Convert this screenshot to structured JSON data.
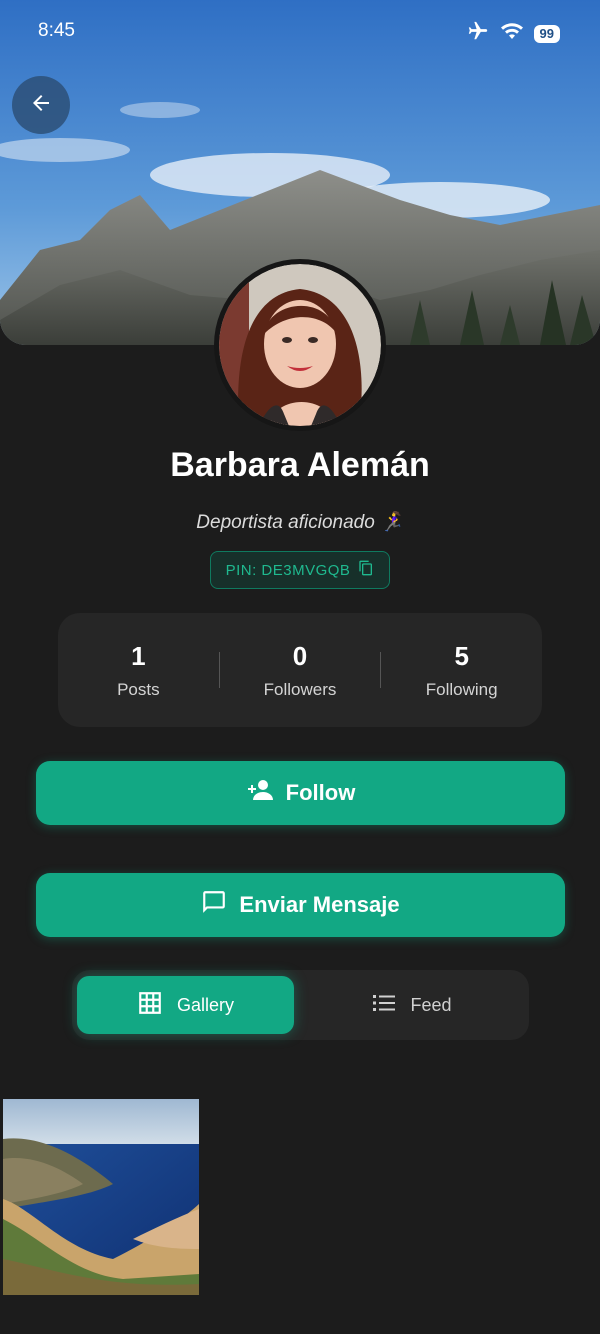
{
  "status_bar": {
    "time": "8:45",
    "battery": "99",
    "icons": [
      "airplane-icon",
      "wifi-icon",
      "battery-icon"
    ]
  },
  "header": {
    "back_icon": "arrow-left-icon"
  },
  "profile": {
    "name": "Barbara Alemán",
    "bio": "Deportista aficionado 🏃‍♀️",
    "pin": "PIN: DE3MVGQB",
    "pin_icon": "copy-icon"
  },
  "stats": [
    {
      "value": "1",
      "label": "Posts"
    },
    {
      "value": "0",
      "label": "Followers"
    },
    {
      "value": "5",
      "label": "Following"
    }
  ],
  "actions": {
    "follow_label": "Follow",
    "follow_icon": "person-add-icon",
    "message_label": "Enviar Mensaje",
    "message_icon": "message-icon"
  },
  "tabs": [
    {
      "label": "Gallery",
      "icon": "grid-icon",
      "active": true
    },
    {
      "label": "Feed",
      "icon": "list-icon",
      "active": false
    }
  ],
  "colors": {
    "accent": "#12a884",
    "background": "#1c1c1c",
    "card": "#262626",
    "pin_text": "#1fb98f"
  }
}
